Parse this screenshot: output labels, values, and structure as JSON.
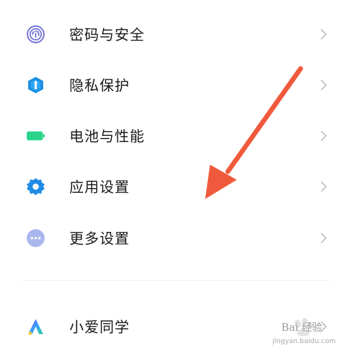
{
  "settings": {
    "items": [
      {
        "label": "密码与安全",
        "icon": "fingerprint-icon",
        "color": "#7b7bd9"
      },
      {
        "label": "隐私保护",
        "icon": "privacy-shield-icon",
        "color": "#1e8fe0"
      },
      {
        "label": "电池与性能",
        "icon": "battery-icon",
        "color": "#2bd48c"
      },
      {
        "label": "应用设置",
        "icon": "gear-icon",
        "color": "#1f8be6"
      },
      {
        "label": "更多设置",
        "icon": "more-dots-icon",
        "color": "#aab6ee"
      },
      {
        "label": "小爱同学",
        "icon": "xiaoai-assistant-icon",
        "color": "#5a6cf0"
      }
    ]
  },
  "annotation": {
    "arrow_color": "#f05a3c"
  },
  "watermark": {
    "brand": "Bai 经验",
    "url": "jingyan.baidu.com"
  }
}
